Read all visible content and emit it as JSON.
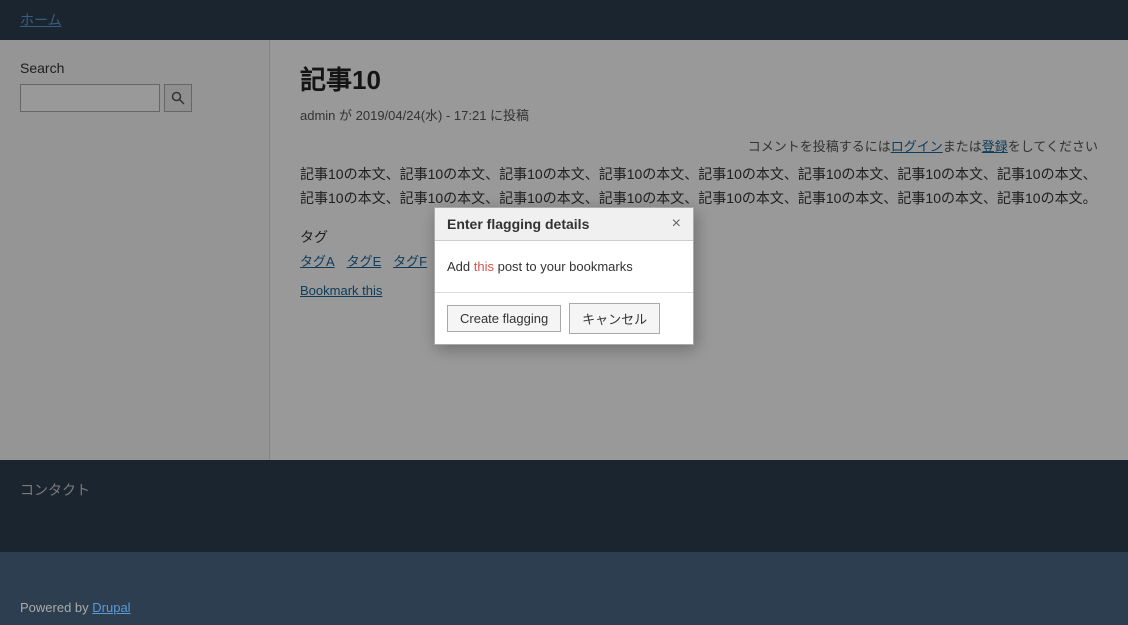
{
  "header": {
    "home_link": "ホーム"
  },
  "sidebar": {
    "search_label": "Search",
    "search_placeholder": "",
    "search_icon": "🔍"
  },
  "main": {
    "title": "記事10",
    "post_meta": "admin が 2019/04/24(水) - 17:21 に投稿",
    "comment_notice_prefix": "コメントを投稿するには",
    "login_text": "ログイン",
    "or_text": "または",
    "register_text": "登録",
    "comment_notice_suffix": "をしてください",
    "body": "記事10の本文、記事10の本文、記事10の本文、記事10の本文、記事10の本文、記事10の本文、記事10の本文、記事10の本文、記事10の本文、記事10の本文、記事10の本文、記事10の本文、記事10の本文、記事10の本文、記事10の本文、記事10の本文。",
    "tags_label": "タグ",
    "tags": [
      {
        "label": "タグA"
      },
      {
        "label": "タグE"
      },
      {
        "label": "タグF"
      }
    ],
    "bookmark_link": "Bookmark this"
  },
  "modal": {
    "title": "Enter flagging details",
    "close_label": "×",
    "body_text_pre": "Add ",
    "body_text_highlight": "this",
    "body_text_post": " post to your bookmarks",
    "create_button": "Create flagging",
    "cancel_button": "キャンセル"
  },
  "footer": {
    "contact_label": "コンタクト",
    "powered_by_prefix": "Powered by ",
    "drupal_link": "Drupal"
  }
}
